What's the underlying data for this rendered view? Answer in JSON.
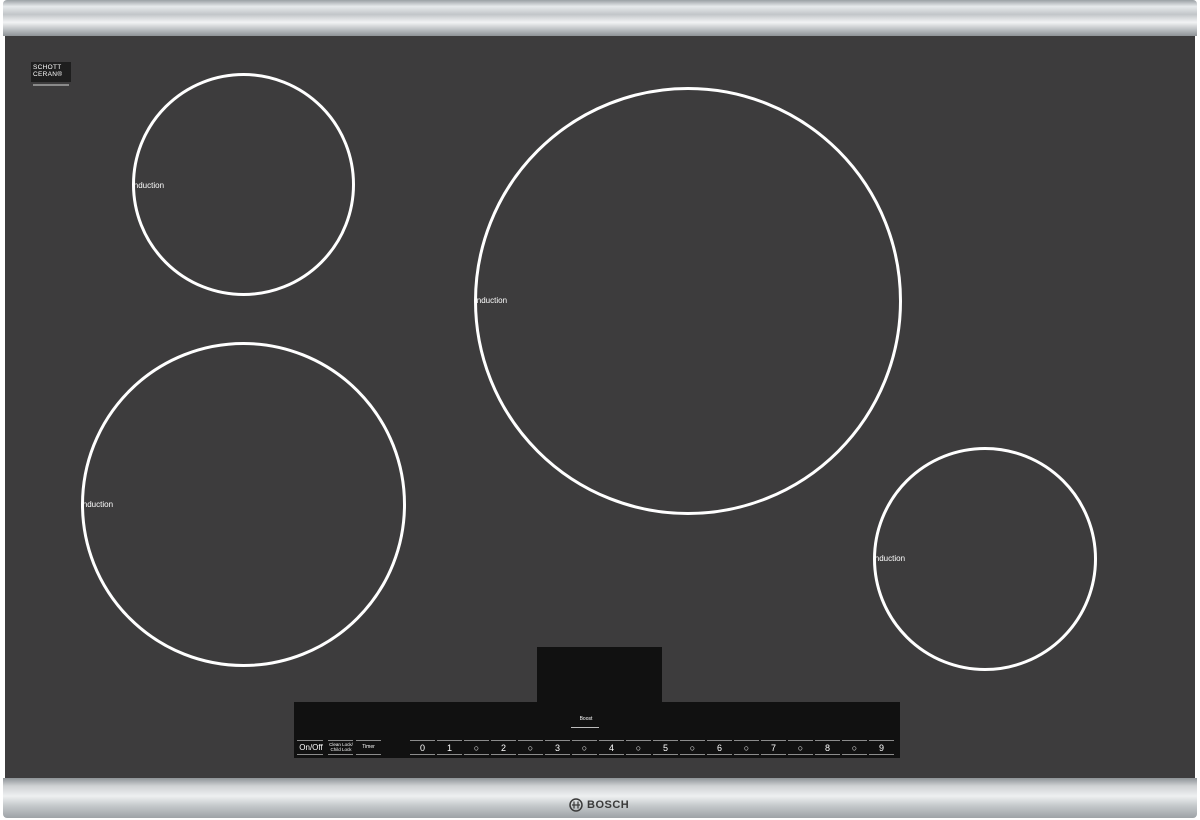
{
  "logo": {
    "line1": "SCHOTT",
    "line2": "CERAN®"
  },
  "burners": [
    {
      "label": "induction"
    },
    {
      "label": "induction"
    },
    {
      "label": "induction"
    },
    {
      "label": "induction"
    }
  ],
  "controls": {
    "boost_label": "Boost",
    "on_off_label": "On/Off",
    "clean_lock_label": "Clean Lock/",
    "child_lock_label": "Child Lock",
    "timer_label": "Timer",
    "power_levels": [
      "0",
      "1",
      "○",
      "2",
      "○",
      "3",
      "○",
      "4",
      "○",
      "5",
      "○",
      "6",
      "○",
      "7",
      "○",
      "8",
      "○",
      "9"
    ]
  },
  "brand": {
    "name": "BOSCH"
  },
  "colors": {
    "glass": "#3d3c3d",
    "panel": "#111111",
    "trim": "#c8cbcd",
    "burner_ring": "#ffffff"
  }
}
